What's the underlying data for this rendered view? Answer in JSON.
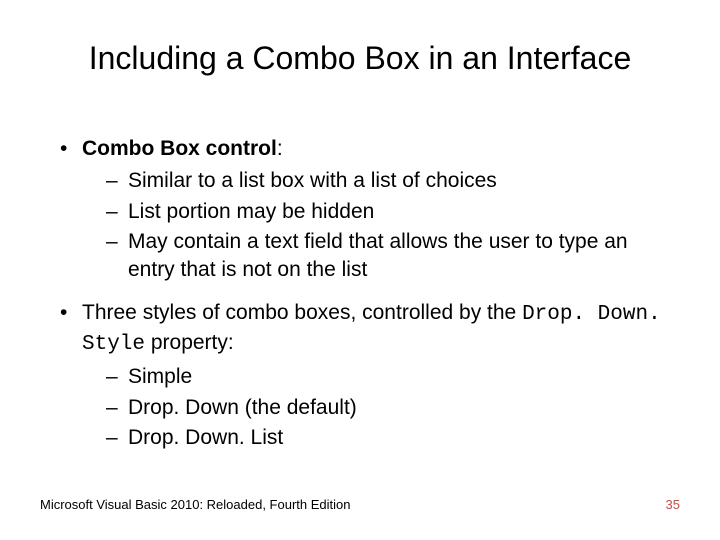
{
  "title": "Including a Combo Box in an Interface",
  "bullet1": {
    "lead": "Combo Box control",
    "colon": ":",
    "subs": [
      "Similar to a list box with a list of choices",
      "List portion may be hidden",
      "May contain a text field that allows the user to type an entry that is not on the list"
    ]
  },
  "bullet2": {
    "text_before_code": "Three styles of combo boxes, controlled by the ",
    "code": "Drop. Down. Style",
    "text_after_code": " property:",
    "subs": [
      "Simple",
      "Drop. Down (the default)",
      "Drop. Down. List"
    ]
  },
  "footer_left": "Microsoft Visual Basic 2010: Reloaded, Fourth Edition",
  "footer_right": "35"
}
